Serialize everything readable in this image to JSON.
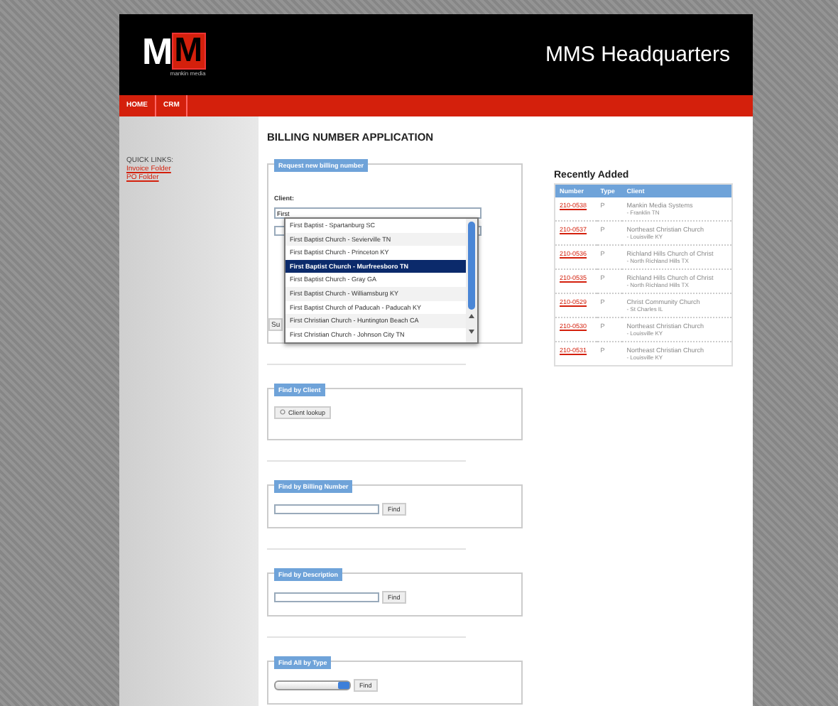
{
  "header": {
    "logo": {
      "letter_left": "M",
      "letter_right": "M",
      "tagline": "mankin media"
    },
    "title": "MMS Headquarters"
  },
  "nav": [
    "HOME",
    "CRM"
  ],
  "sidebar": {
    "heading": "QUICK LINKS:",
    "links": [
      "Invoice Folder",
      "PO Folder"
    ]
  },
  "page_title": "BILLING NUMBER APPLICATION",
  "request_form": {
    "legend": "Request new billing number",
    "client_label": "Client:",
    "client_value": "First",
    "submit_partial": "Su",
    "suggestions": [
      {
        "label": "First Baptist - Spartanburg SC",
        "selected": false
      },
      {
        "label": "First Baptist Church - Sevierville TN",
        "selected": false
      },
      {
        "label": "First Baptist Church - Princeton KY",
        "selected": false
      },
      {
        "label": "First Baptist Church - Murfreesboro TN",
        "selected": true
      },
      {
        "label": "First Baptist Church - Gray GA",
        "selected": false
      },
      {
        "label": "First Baptist Church - Williamsburg KY",
        "selected": false
      },
      {
        "label": "First Baptist Church of Paducah - Paducah KY",
        "selected": false
      },
      {
        "label": "First Christian Church - Huntington Beach CA",
        "selected": false
      },
      {
        "label": "First Christian Church - Johnson City TN",
        "selected": false
      }
    ]
  },
  "search_sections": [
    {
      "legend": "Find by Client",
      "kind": "lookup",
      "button": "Client lookup"
    },
    {
      "legend": "Find by Billing Number",
      "kind": "text",
      "button": "Find"
    },
    {
      "legend": "Find by Description",
      "kind": "text",
      "button": "Find"
    },
    {
      "legend": "Find All by Type",
      "kind": "select",
      "button": "Find"
    }
  ],
  "recently_added": {
    "title": "Recently Added",
    "columns": [
      "Number",
      "Type",
      "Client"
    ],
    "rows": [
      {
        "number": "210-0538",
        "type": "P",
        "client": "Mankin Media Systems",
        "location": "- Franklin TN"
      },
      {
        "number": "210-0537",
        "type": "P",
        "client": "Northeast Christian Church",
        "location": "- Louisville KY"
      },
      {
        "number": "210-0536",
        "type": "P",
        "client": "Richland Hills Church of Christ",
        "location": "- North Richland Hills TX"
      },
      {
        "number": "210-0535",
        "type": "P",
        "client": "Richland Hills Church of Christ",
        "location": "- North Richland Hills TX"
      },
      {
        "number": "210-0529",
        "type": "P",
        "client": "Christ Community Church",
        "location": "- St Charles IL"
      },
      {
        "number": "210-0530",
        "type": "P",
        "client": "Northeast Christian Church",
        "location": "- Louisville KY"
      },
      {
        "number": "210-0531",
        "type": "P",
        "client": "Northeast Christian Church",
        "location": "- Louisville KY"
      }
    ]
  }
}
